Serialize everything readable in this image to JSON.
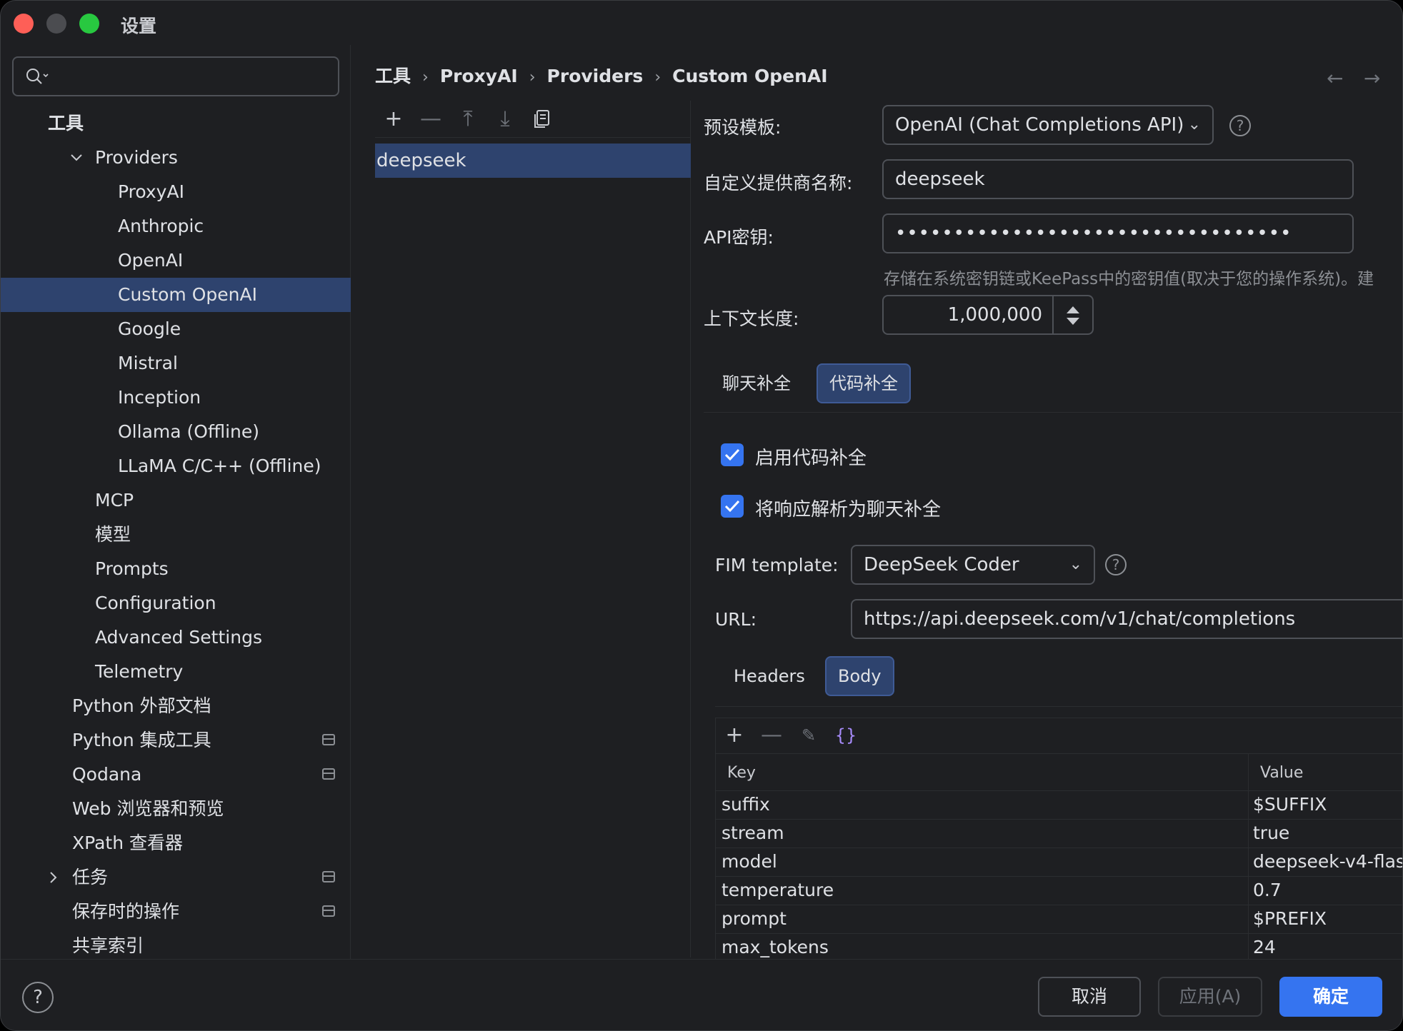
{
  "window": {
    "title": "设置"
  },
  "search": {
    "placeholder": ""
  },
  "sidebar": {
    "items": [
      {
        "label": "工具"
      },
      {
        "label": "Providers"
      },
      {
        "label": "ProxyAI"
      },
      {
        "label": "Anthropic"
      },
      {
        "label": "OpenAI"
      },
      {
        "label": "Custom OpenAI"
      },
      {
        "label": "Google"
      },
      {
        "label": "Mistral"
      },
      {
        "label": "Inception"
      },
      {
        "label": "Ollama (Offline)"
      },
      {
        "label": "LLaMA C/C++ (Offline)"
      },
      {
        "label": "MCP"
      },
      {
        "label": "模型"
      },
      {
        "label": "Prompts"
      },
      {
        "label": "Configuration"
      },
      {
        "label": "Advanced Settings"
      },
      {
        "label": "Telemetry"
      },
      {
        "label": "Python 外部文档"
      },
      {
        "label": "Python 集成工具"
      },
      {
        "label": "Qodana"
      },
      {
        "label": "Web 浏览器和预览"
      },
      {
        "label": "XPath 查看器"
      },
      {
        "label": "任务"
      },
      {
        "label": "保存时的操作"
      },
      {
        "label": "共享索引"
      }
    ]
  },
  "breadcrumb": [
    "工具",
    "ProxyAI",
    "Providers",
    "Custom OpenAI"
  ],
  "providers_list": {
    "items": [
      "deepseek"
    ]
  },
  "form": {
    "preset_label": "预设模板:",
    "preset_value": "OpenAI (Chat Completions API)",
    "name_label": "自定义提供商名称:",
    "name_value": "deepseek",
    "apikey_label": "API密钥:",
    "apikey_value": "••••••••••••••••••••••••••••••••••",
    "apikey_hint": "存储在系统密钥链或KeePass中的密钥值(取决于您的操作系统)。建",
    "context_label": "上下文长度:",
    "context_value": "1,000,000"
  },
  "tabs": {
    "chat": "聊天补全",
    "code": "代码补全"
  },
  "code": {
    "enable_label": "启用代码补全",
    "parse_label": "将响应解析为聊天补全",
    "fim_label": "FIM template:",
    "fim_value": "DeepSeek Coder",
    "url_label": "URL:",
    "url_value": "https://api.deepseek.com/v1/chat/completions"
  },
  "subtabs": {
    "headers": "Headers",
    "body": "Body"
  },
  "table": {
    "columns": [
      "Key",
      "Value"
    ],
    "rows": [
      {
        "key": "suffix",
        "value": "$SUFFIX"
      },
      {
        "key": "stream",
        "value": "true"
      },
      {
        "key": "model",
        "value": "deepseek-v4-flas"
      },
      {
        "key": "temperature",
        "value": "0.7"
      },
      {
        "key": "prompt",
        "value": "$PREFIX"
      },
      {
        "key": "max_tokens",
        "value": "24"
      }
    ]
  },
  "footer": {
    "help": "?",
    "cancel": "取消",
    "apply": "应用(A)",
    "ok": "确定"
  },
  "colors": {
    "accent": "#3574f0",
    "selection": "#2e436e",
    "background": "#1e1f22"
  }
}
